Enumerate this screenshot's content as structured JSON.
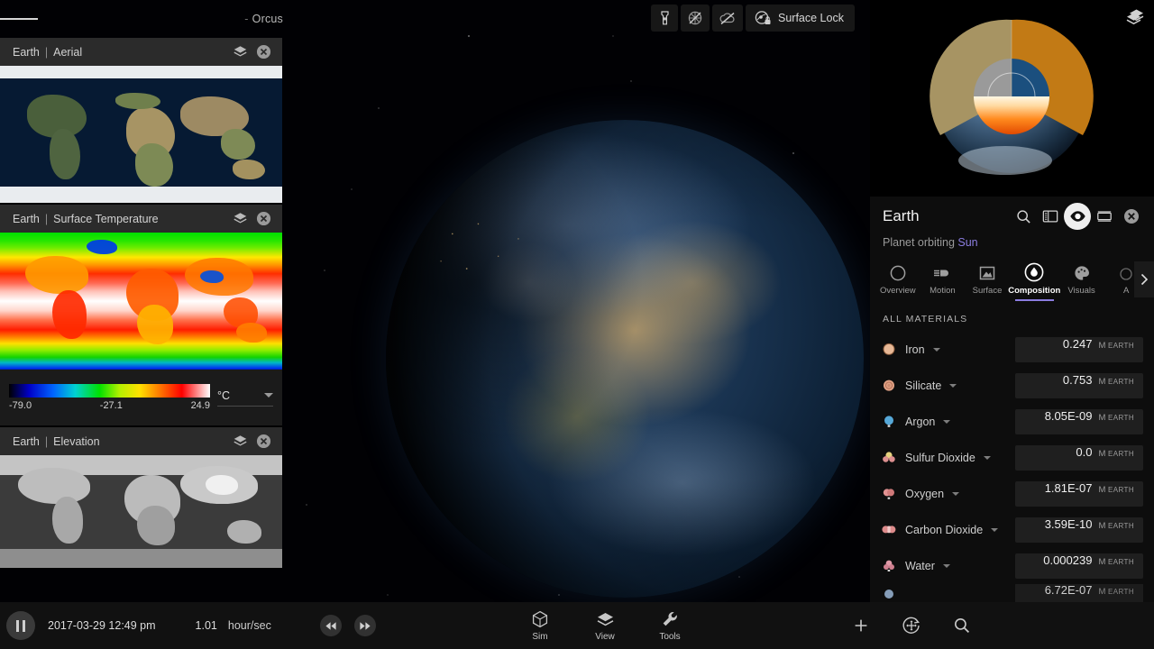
{
  "window": {
    "context_label": "Orcus",
    "context_dot": "-"
  },
  "top_toolbar": {
    "buttons": [
      {
        "name": "flashlight",
        "icon": "flashlight-icon",
        "label": ""
      },
      {
        "name": "grid-off",
        "icon": "grid-off-icon",
        "label": ""
      },
      {
        "name": "clouds-off",
        "icon": "cloud-off-icon",
        "label": ""
      },
      {
        "name": "surface-lock",
        "icon": "surface-lock-icon",
        "label": "Surface Lock"
      }
    ]
  },
  "map_panels": [
    {
      "body": "Earth",
      "layer": "Aerial",
      "separator": "|",
      "type": "aerial"
    },
    {
      "body": "Earth",
      "layer": "Surface Temperature",
      "separator": "|",
      "type": "temperature",
      "legend": {
        "min": "-79.0",
        "mid": "-27.1",
        "max": "24.9",
        "unit": "°C"
      }
    },
    {
      "body": "Earth",
      "layer": "Elevation",
      "separator": "|",
      "type": "elevation"
    }
  ],
  "right_panel": {
    "title": "Earth",
    "subtitle_prefix": "Planet orbiting ",
    "subtitle_link": "Sun",
    "header_icons": [
      {
        "name": "search-icon"
      },
      {
        "name": "details-panel-icon"
      },
      {
        "name": "visibility-eye-icon",
        "active": true
      },
      {
        "name": "timeline-icon"
      },
      {
        "name": "close-icon"
      }
    ],
    "tabs": [
      {
        "label": "Overview",
        "icon": "circle-icon",
        "active": false
      },
      {
        "label": "Motion",
        "icon": "motion-icon",
        "active": false
      },
      {
        "label": "Surface",
        "icon": "surface-icon",
        "active": false
      },
      {
        "label": "Composition",
        "icon": "droplet-icon",
        "active": true
      },
      {
        "label": "Visuals",
        "icon": "palette-icon",
        "active": false
      },
      {
        "label": "A",
        "icon": "more-icon",
        "active": false
      }
    ],
    "section_title": "ALL MATERIALS",
    "unit_label_m": "M",
    "unit_label_earth": "EARTH",
    "materials": [
      {
        "name": "Iron",
        "value": "0.247",
        "unit_m": "M",
        "unit_body": "EARTH",
        "swatch": "#e0b094"
      },
      {
        "name": "Silicate",
        "value": "0.753",
        "unit_m": "M",
        "unit_body": "EARTH",
        "swatch": "#d99d82"
      },
      {
        "name": "Argon",
        "value": "8.05E-09",
        "unit_m": "M",
        "unit_body": "EARTH",
        "swatch": "#56a8d8"
      },
      {
        "name": "Sulfur Dioxide",
        "value": "0.0",
        "unit_m": "M",
        "unit_body": "EARTH",
        "swatch": "#e3cd7c"
      },
      {
        "name": "Oxygen",
        "value": "1.81E-07",
        "unit_m": "M",
        "unit_body": "EARTH",
        "swatch": "#e08f8f"
      },
      {
        "name": "Carbon Dioxide",
        "value": "3.59E-10",
        "unit_m": "M",
        "unit_body": "EARTH",
        "swatch": "#d98787"
      },
      {
        "name": "Water",
        "value": "0.000239",
        "unit_m": "M",
        "unit_body": "EARTH",
        "swatch": "#d98c9c"
      },
      {
        "name": "",
        "value": "6.72E-07",
        "unit_m": "M",
        "unit_body": "EARTH",
        "swatch": "#9ab7d6"
      }
    ]
  },
  "bottom_bar": {
    "play_state": "paused",
    "sim_time": "2017-03-29 12:49 pm",
    "rate_value": "1.01",
    "rate_unit": "hour/sec",
    "step_back": "step-back-icon",
    "step_forward": "step-forward-icon",
    "mid_tools": [
      {
        "label": "Sim",
        "icon": "cube-icon"
      },
      {
        "label": "View",
        "icon": "layers-icon"
      },
      {
        "label": "Tools",
        "icon": "wrench-icon"
      }
    ],
    "right_tools": [
      {
        "name": "add-icon"
      },
      {
        "name": "orbit-move-icon"
      },
      {
        "name": "search-icon"
      }
    ]
  },
  "colors": {
    "accent": "#8b7de0",
    "panel_bg": "#0d0d0d",
    "value_bg": "#1f1f1f"
  }
}
